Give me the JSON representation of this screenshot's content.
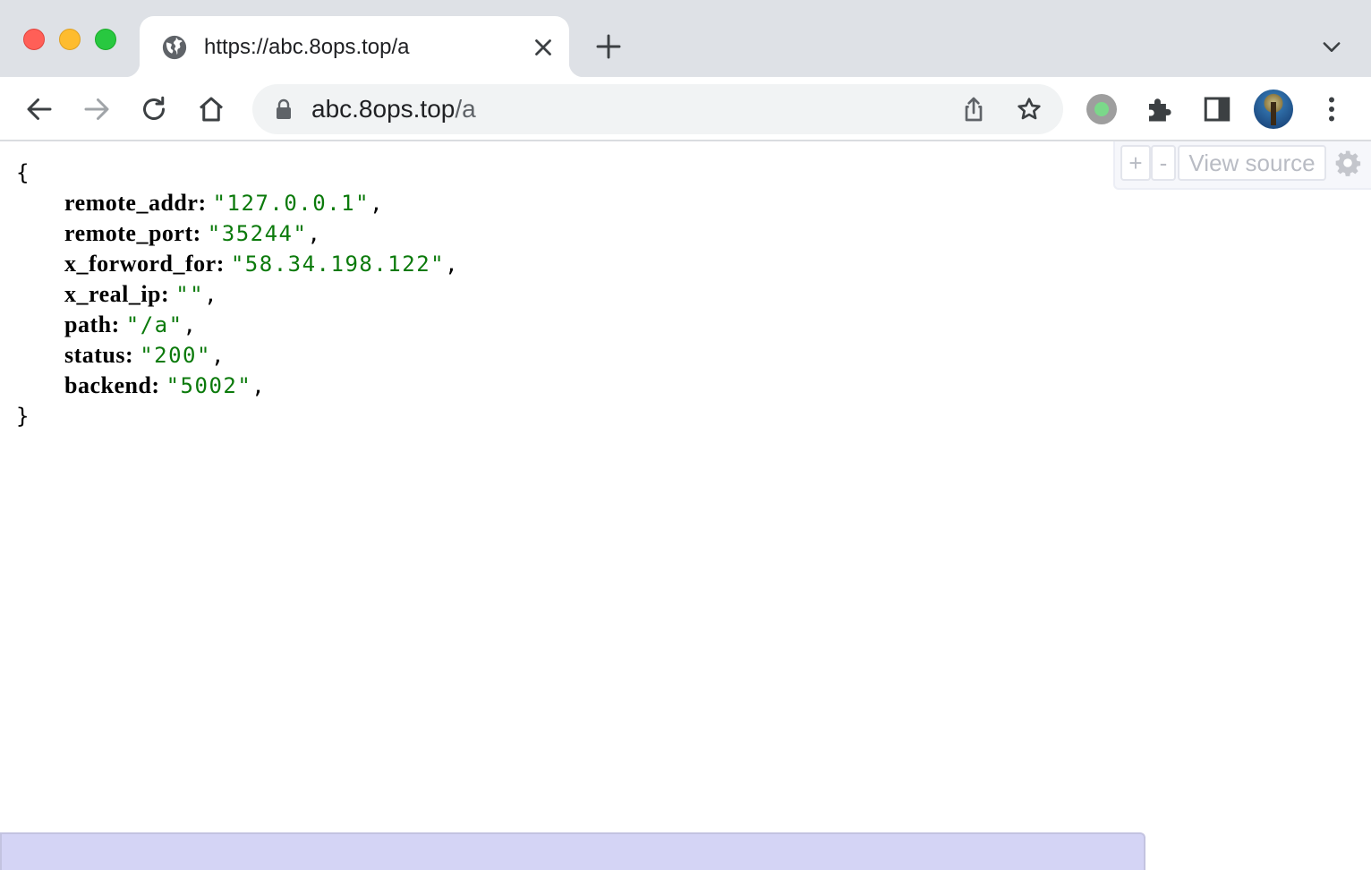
{
  "browser": {
    "tab": {
      "title": "https://abc.8ops.top/a"
    },
    "address_bar": {
      "host": "abc.8ops.top",
      "path": "/a"
    }
  },
  "json_viewer": {
    "open_brace": "{",
    "close_brace": "}",
    "entries": [
      {
        "key": "remote_addr",
        "value": "\"127.0.0.1\""
      },
      {
        "key": "remote_port",
        "value": "\"35244\""
      },
      {
        "key": "x_forword_for",
        "value": "\"58.34.198.122\""
      },
      {
        "key": "x_real_ip",
        "value": "\"\""
      },
      {
        "key": "path",
        "value": "\"/a\""
      },
      {
        "key": "status",
        "value": "\"200\""
      },
      {
        "key": "backend",
        "value": "\"5002\""
      }
    ],
    "controls": {
      "expand_label": "+",
      "collapse_label": "-",
      "view_source_label": "View source"
    },
    "colors": {
      "string": "#0b7a0b",
      "key": "#000000"
    }
  },
  "icons": {
    "favicon": "globe-icon",
    "tab_close": "close-icon",
    "new_tab": "plus-icon",
    "tab_search": "chevron-down-icon",
    "back": "arrow-left-icon",
    "forward": "arrow-right-icon",
    "reload": "reload-icon",
    "home": "home-icon",
    "lock": "lock-icon",
    "share": "share-icon",
    "bookmark": "star-icon",
    "extension_record": "record-icon",
    "extensions": "puzzle-icon",
    "side_panel": "side-panel-icon",
    "menu": "kebab-menu-icon",
    "settings": "gear-icon"
  }
}
